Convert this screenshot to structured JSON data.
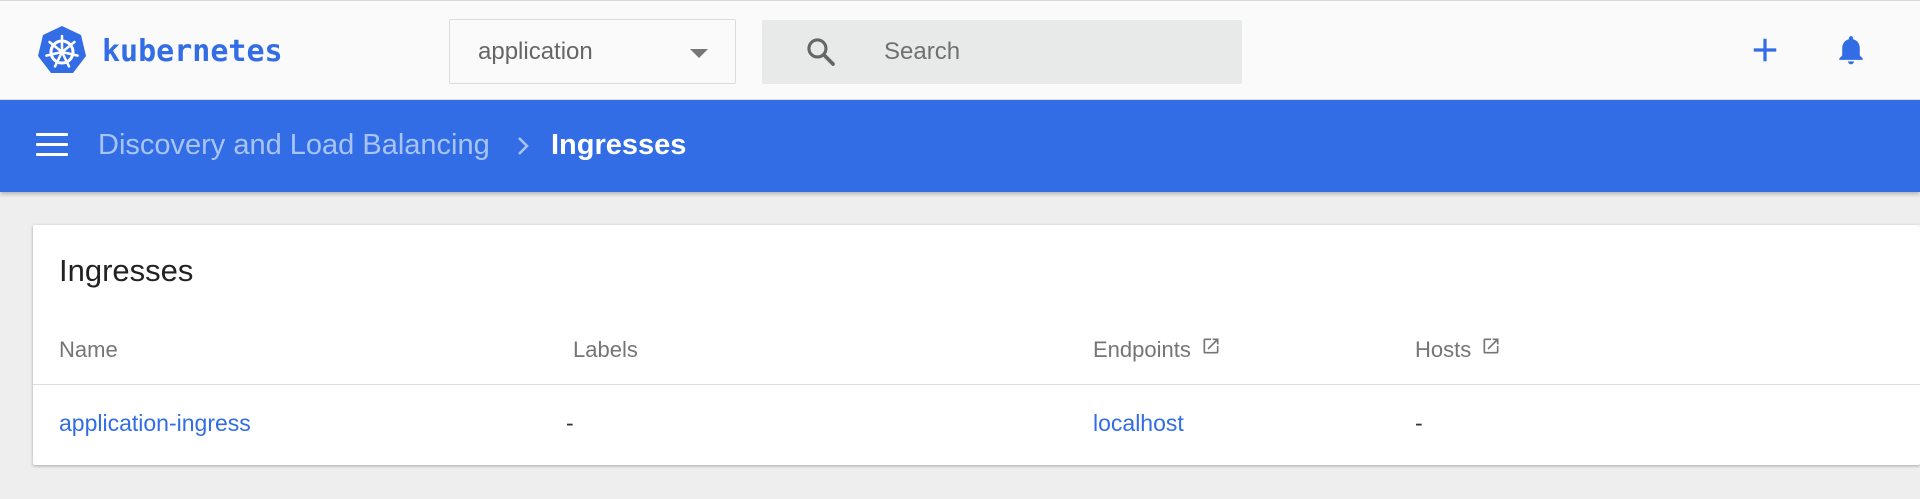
{
  "app": {
    "logo_text": "kubernetes",
    "brand_color": "#326de6"
  },
  "namespace_selector": {
    "value": "application"
  },
  "search": {
    "placeholder": "Search"
  },
  "toolbar": {
    "create_icon": "plus-icon",
    "notifications_icon": "bell-icon"
  },
  "breadcrumb": {
    "parent": "Discovery and Load Balancing",
    "current": "Ingresses"
  },
  "card": {
    "title": "Ingresses",
    "columns": [
      "Name",
      "Labels",
      "Endpoints",
      "Hosts"
    ],
    "rows": [
      {
        "name": "application-ingress",
        "labels": "-",
        "endpoints": "localhost",
        "hosts": "-"
      }
    ]
  }
}
